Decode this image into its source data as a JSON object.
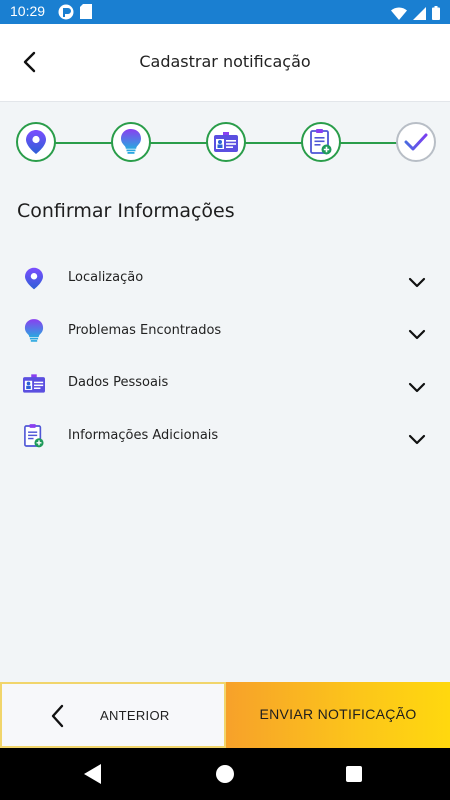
{
  "status_bar": {
    "time": "10:29",
    "icons_left": [
      "notification-app-icon",
      "sd-card-icon"
    ],
    "icons_right": [
      "wifi-icon",
      "signal-icon",
      "battery-icon"
    ],
    "color": "#1a7fd1"
  },
  "app_bar": {
    "title": "Cadastrar notificação",
    "back_icon": "back-arrow-icon"
  },
  "stepper": {
    "steps": [
      {
        "icon": "location-pin-icon",
        "state": "done"
      },
      {
        "icon": "lightbulb-icon",
        "state": "done"
      },
      {
        "icon": "id-badge-icon",
        "state": "done"
      },
      {
        "icon": "clipboard-add-icon",
        "state": "done"
      },
      {
        "icon": "checkmark-icon",
        "state": "current"
      }
    ],
    "accent": "#2a9d4a"
  },
  "section": {
    "title": "Confirmar Informações"
  },
  "info_items": [
    {
      "label": "Localização",
      "icon": "location-pin-icon"
    },
    {
      "label": "Problemas Encontrados",
      "icon": "lightbulb-icon"
    },
    {
      "label": "Dados Pessoais",
      "icon": "id-badge-icon"
    },
    {
      "label": "Informações Adicionais",
      "icon": "clipboard-add-icon"
    }
  ],
  "buttons": {
    "previous_label": "ANTERIOR",
    "send_label": "ENVIAR NOTIFICAÇÃO"
  },
  "nav_bar": {
    "icons": [
      "nav-back-icon",
      "nav-home-icon",
      "nav-recents-icon"
    ]
  }
}
